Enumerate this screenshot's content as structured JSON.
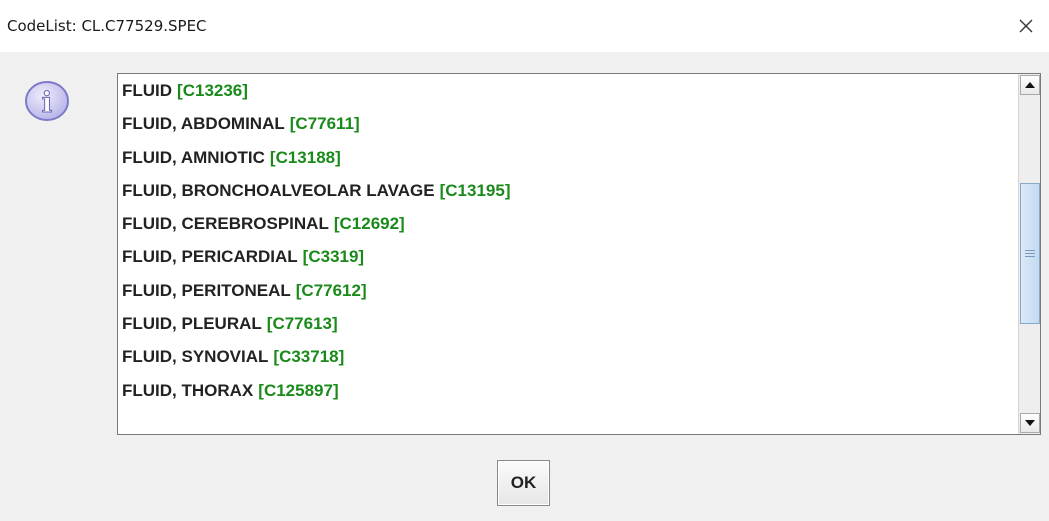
{
  "window": {
    "title": "CodeList: CL.C77529.SPEC",
    "close_icon": "close-icon"
  },
  "dialog": {
    "icon": "info-icon",
    "icon_glyph": "i",
    "colors": {
      "term_text": "#222222",
      "code_text": "#1a8a1a",
      "info_icon_fill": "#c9c7ef",
      "info_icon_border": "#7d79c9"
    }
  },
  "list": {
    "items": [
      {
        "name": "FLUID",
        "code": "[C13236]"
      },
      {
        "name": "FLUID, ABDOMINAL",
        "code": "[C77611]"
      },
      {
        "name": "FLUID, AMNIOTIC",
        "code": "[C13188]"
      },
      {
        "name": "FLUID, BRONCHOALVEOLAR LAVAGE",
        "code": "[C13195]"
      },
      {
        "name": "FLUID, CEREBROSPINAL",
        "code": "[C12692]"
      },
      {
        "name": "FLUID, PERICARDIAL",
        "code": "[C3319]"
      },
      {
        "name": "FLUID, PERITONEAL",
        "code": "[C77612]"
      },
      {
        "name": "FLUID, PLEURAL",
        "code": "[C77613]"
      },
      {
        "name": "FLUID, SYNOVIAL",
        "code": "[C33718]"
      },
      {
        "name": "FLUID, THORAX",
        "code": "[C125897]"
      }
    ]
  },
  "buttons": {
    "ok_label": "OK"
  }
}
